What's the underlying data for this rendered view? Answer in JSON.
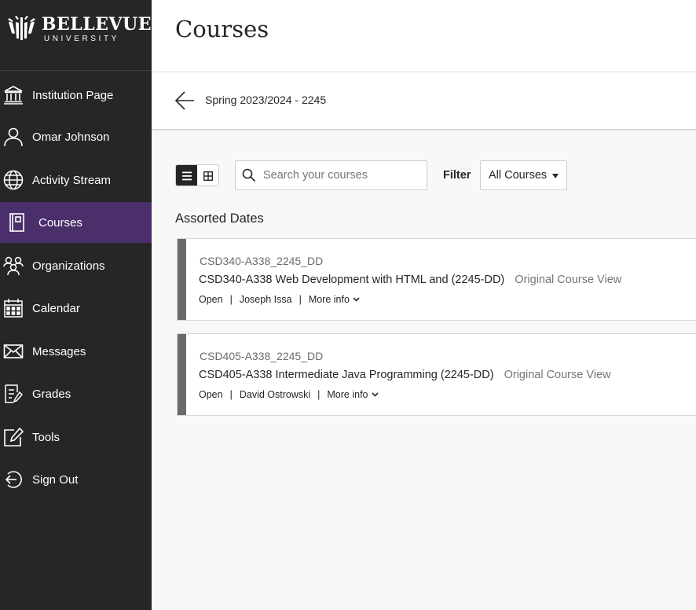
{
  "brand": {
    "name": "BELLEVUE",
    "subtitle": "UNIVERSITY"
  },
  "sidebar": {
    "items": [
      {
        "label": "Institution Page",
        "icon": "institution-icon"
      },
      {
        "label": "Omar Johnson",
        "icon": "user-icon"
      },
      {
        "label": "Activity Stream",
        "icon": "globe-icon"
      },
      {
        "label": "Courses",
        "icon": "courses-icon",
        "active": true
      },
      {
        "label": "Organizations",
        "icon": "organizations-icon"
      },
      {
        "label": "Calendar",
        "icon": "calendar-icon"
      },
      {
        "label": "Messages",
        "icon": "envelope-icon"
      },
      {
        "label": "Grades",
        "icon": "grades-icon"
      },
      {
        "label": "Tools",
        "icon": "tools-icon"
      },
      {
        "label": "Sign Out",
        "icon": "sign-out-icon"
      }
    ]
  },
  "header": {
    "title": "Courses"
  },
  "term": {
    "label": "Spring 2023/2024 - 2245"
  },
  "toolbar": {
    "search_placeholder": "Search your courses",
    "filter_label": "Filter",
    "filter_value": "All Courses"
  },
  "section": {
    "title": "Assorted Dates"
  },
  "courses": [
    {
      "code": "CSD340-A338_2245_DD",
      "name": "CSD340-A338 Web Development with HTML and (2245-DD)",
      "view": "Original Course View",
      "status": "Open",
      "instructor": "Joseph Issa",
      "more": "More info"
    },
    {
      "code": "CSD405-A338_2245_DD",
      "name": "CSD405-A338 Intermediate Java Programming (2245-DD)",
      "view": "Original Course View",
      "status": "Open",
      "instructor": "David Ostrowski",
      "more": "More info"
    }
  ],
  "colors": {
    "sidebar_bg": "#262626",
    "active_bg": "#4b2f6b",
    "card_stripe": "#6a6a6a"
  }
}
